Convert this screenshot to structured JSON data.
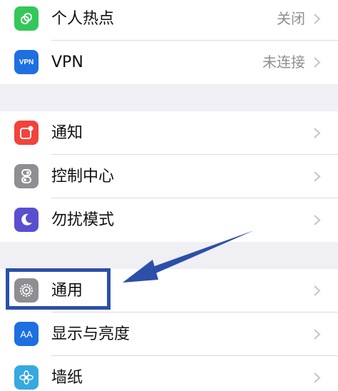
{
  "groups": [
    {
      "items": [
        {
          "label": "个人热点",
          "value": "关闭",
          "icon": "hotspot-icon",
          "color": "#34c759"
        },
        {
          "label": "VPN",
          "value": "未连接",
          "icon": "vpn-icon",
          "color": "#1e6fe0"
        }
      ]
    },
    {
      "items": [
        {
          "label": "通知",
          "icon": "notification-icon",
          "color": "#f2433a"
        },
        {
          "label": "控制中心",
          "icon": "control-center-icon",
          "color": "#8e8e93"
        },
        {
          "label": "勿扰模式",
          "icon": "moon-icon",
          "color": "#5a4fcf"
        }
      ]
    },
    {
      "items": [
        {
          "label": "通用",
          "icon": "gear-icon",
          "color": "#8e8e93"
        },
        {
          "label": "显示与亮度",
          "icon": "display-icon",
          "color": "#1e6fe0"
        },
        {
          "label": "墙纸",
          "icon": "wallpaper-icon",
          "color": "#36a9e0"
        }
      ]
    }
  ],
  "vpn_icon_text": "VPN",
  "display_icon_text": "AA",
  "annotation": {
    "color": "#2c4fa8"
  }
}
